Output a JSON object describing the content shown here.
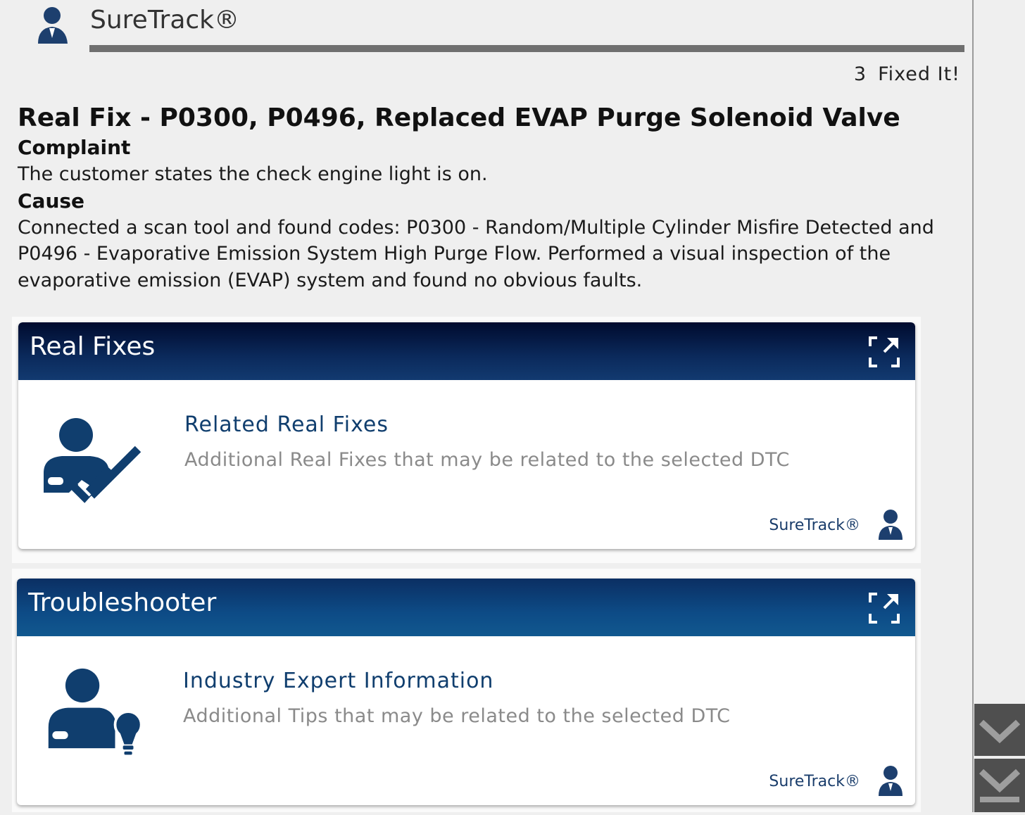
{
  "header": {
    "brand": "SureTrack®",
    "fixed_count": "3",
    "fixed_label": "Fixed It!"
  },
  "fix": {
    "title": "Real Fix - P0300, P0496, Replaced EVAP Purge Solenoid Valve",
    "complaint_label": "Complaint",
    "complaint_text": "The customer states the check engine light is on.",
    "cause_label": "Cause",
    "cause_text": "Connected a scan tool and found codes: P0300 - Random/Multiple Cylinder Misfire Detected and P0496 - Evaporative Emission System High Purge Flow. Performed a visual inspection of the evaporative emission (EVAP) system and found no obvious faults."
  },
  "cards": {
    "real_fixes": {
      "header": "Real Fixes",
      "link": "Related Real Fixes",
      "description": "Additional Real Fixes that may be related to the selected DTC",
      "brand": "SureTrack®"
    },
    "troubleshooter": {
      "header": "Troubleshooter",
      "link": "Industry Expert Information",
      "description": "Additional Tips that may be related to the selected DTC",
      "brand": "SureTrack®"
    }
  },
  "icons": {
    "logo": "person-icon",
    "expand": "expand-icon",
    "real_fixes": "person-checkmark-icon",
    "troubleshooter": "person-lightbulb-icon",
    "scroll_down": "chevron-down-icon",
    "scroll_end": "chevron-down-end-icon"
  },
  "colors": {
    "accent": "#103e6e",
    "real_fixes_header": "#0b2a5c",
    "troubleshooter_header": "#0d4b86"
  }
}
